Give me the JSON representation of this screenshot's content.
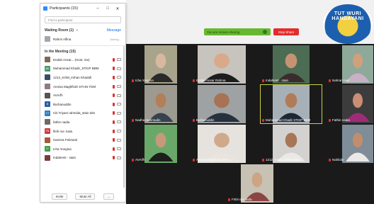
{
  "panel": {
    "title": "Participants (15)",
    "window_buttons": [
      "–",
      "□",
      "✕"
    ],
    "search_placeholder": "Find a participant",
    "waiting_room": {
      "label": "Waiting Room (1)",
      "chevron": "∨",
      "message": "Message",
      "name": "Rahmi Alfina",
      "status": "Joining..."
    },
    "in_meeting_label": "In the Meeting (15)",
    "participants": [
      {
        "name": "Endah Ansar... (Host, me)",
        "color": "#7b6a5a"
      },
      {
        "name": "Muhammad Khadir_STKIP BBM",
        "color": "#4a9a6a",
        "initials": "MK"
      },
      {
        "name": "1212_KOM_Irshan Khadafi",
        "color": "#3b4a66"
      },
      {
        "name": "Annisa Maghfirah STAIN TDM",
        "color": "#8f7a88"
      },
      {
        "name": "AVArfh",
        "color": "#555555"
      },
      {
        "name": "Burhanuddin",
        "color": "#2d5ea8",
        "initials": "B"
      },
      {
        "name": "Citi Triyani rahmida_stain tdm",
        "color": "#2b7fc1",
        "initials": "CT"
      },
      {
        "name": "fathin nadia",
        "color": "#6a6a6a"
      },
      {
        "name": "fitriti nur Juda",
        "color": "#d23b3b",
        "initials": "FN"
      },
      {
        "name": "Hasrina Febrianti",
        "color": "#a05c3b"
      },
      {
        "name": "Icha Yongina",
        "color": "#43a047",
        "initials": "IY"
      },
      {
        "name": "Indahenti · stain",
        "color": "#7d3a3a"
      }
    ],
    "footer": {
      "invite": "Invite",
      "mute_all": "Mute All",
      "more": "..."
    }
  },
  "recording": {
    "text": "You are screen sharing",
    "stop": "Stop Share"
  },
  "background": {
    "logo_text": "TUT WURI HANDAYANI"
  },
  "gallery": [
    {
      "name": "Icha Yongina",
      "skin": "#d8b8a0",
      "bg": "#a8a48c",
      "shirt": "#2a2a2a"
    },
    {
      "name": "Endah Ansar Rahma",
      "skin": "#d9a98a",
      "bg": "#c7c3bd",
      "shirt": "#1d1d1d"
    },
    {
      "name": "Indahenti · stain",
      "skin": "#c59373",
      "bg": "#4c6c54",
      "shirt": "#3a2c2c"
    },
    {
      "name": "Nahrani sari",
      "skin": "#d0a07a",
      "bg": "#8ea89a",
      "shirt": "#c9b0c6"
    },
    {
      "name": "Nadha mahmudin",
      "skin": "#b27f5a",
      "bg": "#9d9a92",
      "shirt": "#35424f"
    },
    {
      "name": "Burhanuddin",
      "skin": "#a77353",
      "bg": "#9ea2a3",
      "shirt": "#26313f"
    },
    {
      "name": "Muhammad Khadir STKIP BBM",
      "skin": "#b17b58",
      "bg": "#a7b0b7",
      "shirt": "#1d2733"
    },
    {
      "name": "Fathin nadia",
      "skin": "#c98e73",
      "bg": "#3c3c3c",
      "shirt": "#9e2b7a"
    },
    {
      "name": "AVArfh",
      "skin": "#c49a7b",
      "bg": "#6aa86a",
      "shirt": "#1e1e1e"
    },
    {
      "name": "Annisa Maghfirah STAI...",
      "skin": "#d0a98c",
      "bg": "#e6e3df",
      "shirt": "#e9e4de"
    },
    {
      "name": "1212_KOM_Irshan Kha...",
      "skin": "#a87656",
      "bg": "#d3d2d0",
      "shirt": "#ebe9e6"
    },
    {
      "name": "Nahlidar",
      "skin": "#c28d6d",
      "bg": "#7e8d97",
      "shirt": "#ece8e6"
    },
    {
      "name": "Fitriti nur Juda",
      "skin": "#cda484",
      "bg": "#c7c2b3",
      "shirt": "#8c4545"
    }
  ]
}
